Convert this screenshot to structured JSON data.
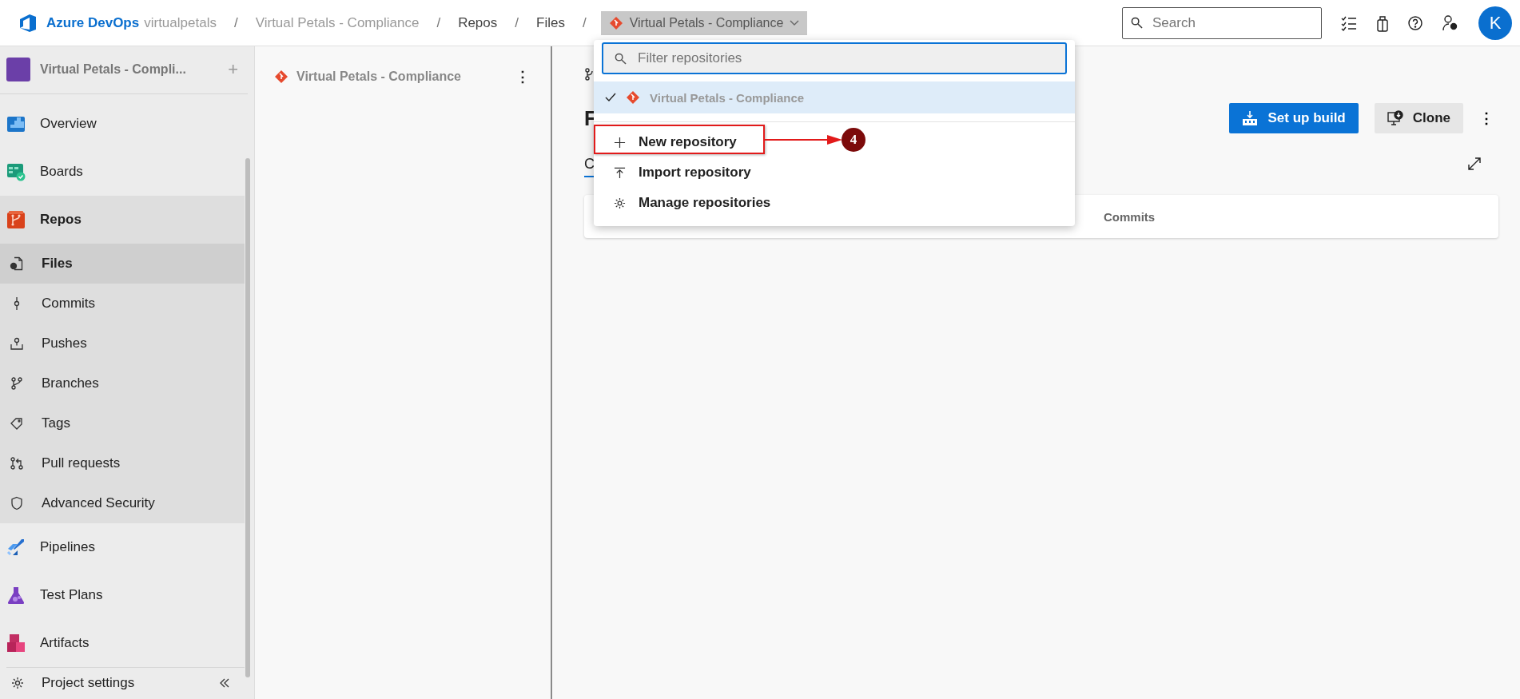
{
  "header": {
    "logo_text": "Azure DevOps",
    "separator": "/",
    "breadcrumbs": [
      {
        "label": "virtualpetals"
      },
      {
        "label": "Virtual Petals - Compliance"
      },
      {
        "label": "Repos"
      },
      {
        "label": "Files"
      }
    ],
    "repo_selector": "Virtual Petals - Compliance",
    "search": {
      "placeholder": "Search"
    },
    "avatar": "K"
  },
  "sidebar": {
    "project": "Virtual Petals - Compli...",
    "add_label": "+",
    "items": [
      {
        "label": "Overview",
        "kind": "overview",
        "selected": false
      },
      {
        "label": "Boards",
        "kind": "boards",
        "selected": false
      },
      {
        "label": "Repos",
        "kind": "repos",
        "selected": false,
        "expanded": true,
        "children": [
          {
            "label": "Files",
            "kind": "files",
            "selected": true
          },
          {
            "label": "Commits",
            "kind": "commits",
            "selected": false
          },
          {
            "label": "Pushes",
            "kind": "pushes",
            "selected": false
          },
          {
            "label": "Branches",
            "kind": "branches",
            "selected": false
          },
          {
            "label": "Tags",
            "kind": "tags",
            "selected": false
          },
          {
            "label": "Pull requests",
            "kind": "pulls",
            "selected": false
          },
          {
            "label": "Advanced Security",
            "kind": "security",
            "selected": false
          }
        ]
      },
      {
        "label": "Pipelines",
        "kind": "pipelines",
        "selected": false
      },
      {
        "label": "Test Plans",
        "kind": "testplans",
        "selected": false
      },
      {
        "label": "Artifacts",
        "kind": "artifacts",
        "selected": false
      }
    ],
    "footer": "Project settings"
  },
  "repo_panel": {
    "title": "Virtual Petals - Compliance",
    "menu": "⋮"
  },
  "main": {
    "heading": "F",
    "menu": "⋮",
    "tab": {
      "label": "C",
      "selected": true
    },
    "buttons": [
      {
        "label": "Set up build",
        "kind": "primary"
      },
      {
        "label": "Clone",
        "kind": "secondary"
      }
    ],
    "card_column": "Commits"
  },
  "dropdown": {
    "filter_placeholder": "Filter repositories",
    "repos": [
      {
        "label": "Virtual Petals - Compliance",
        "selected": true
      }
    ],
    "actions": [
      {
        "label": "New repository",
        "kind": "new",
        "highlighted": true
      },
      {
        "label": "Import repository",
        "kind": "import",
        "highlighted": false
      },
      {
        "label": "Manage repositories",
        "kind": "manage",
        "highlighted": false
      }
    ]
  },
  "annotation": {
    "number": "4"
  }
}
